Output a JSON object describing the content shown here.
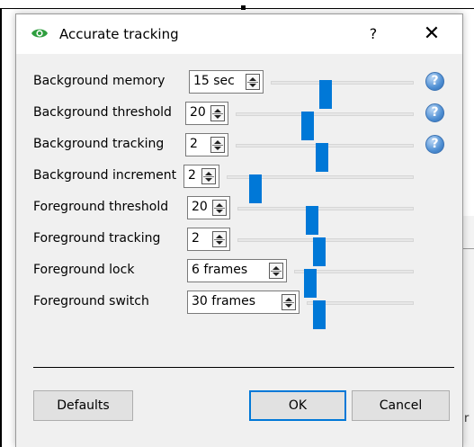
{
  "dialog": {
    "title": "Accurate tracking",
    "help_label": "?",
    "close_label": "✕",
    "help_icon_text": "?"
  },
  "settings": [
    {
      "label": "Background memory",
      "value": "15 sec",
      "slider": 0.38,
      "help": true
    },
    {
      "label": "Background threshold",
      "value": "20",
      "slider": 0.4,
      "help": true
    },
    {
      "label": "Background tracking",
      "value": "2",
      "slider": 0.48,
      "help": true
    },
    {
      "label": "Background increment",
      "value": "2",
      "slider": 0.15,
      "help": false
    },
    {
      "label": "Foreground threshold",
      "value": "20",
      "slider": 0.42,
      "help": false
    },
    {
      "label": "Foreground tracking",
      "value": "2",
      "slider": 0.46,
      "help": false
    },
    {
      "label": "Foreground lock",
      "value": "6 frames",
      "slider": 0.13,
      "help": false
    },
    {
      "label": "Foreground switch",
      "value": "30 frames",
      "slider": 0.11,
      "help": false
    }
  ],
  "buttons": {
    "defaults": "Defaults",
    "ok": "OK",
    "cancel": "Cancel"
  },
  "background": {
    "edge_char": "r"
  },
  "colors": {
    "accent": "#0078d7",
    "icon_green": "#2e9e3e"
  }
}
